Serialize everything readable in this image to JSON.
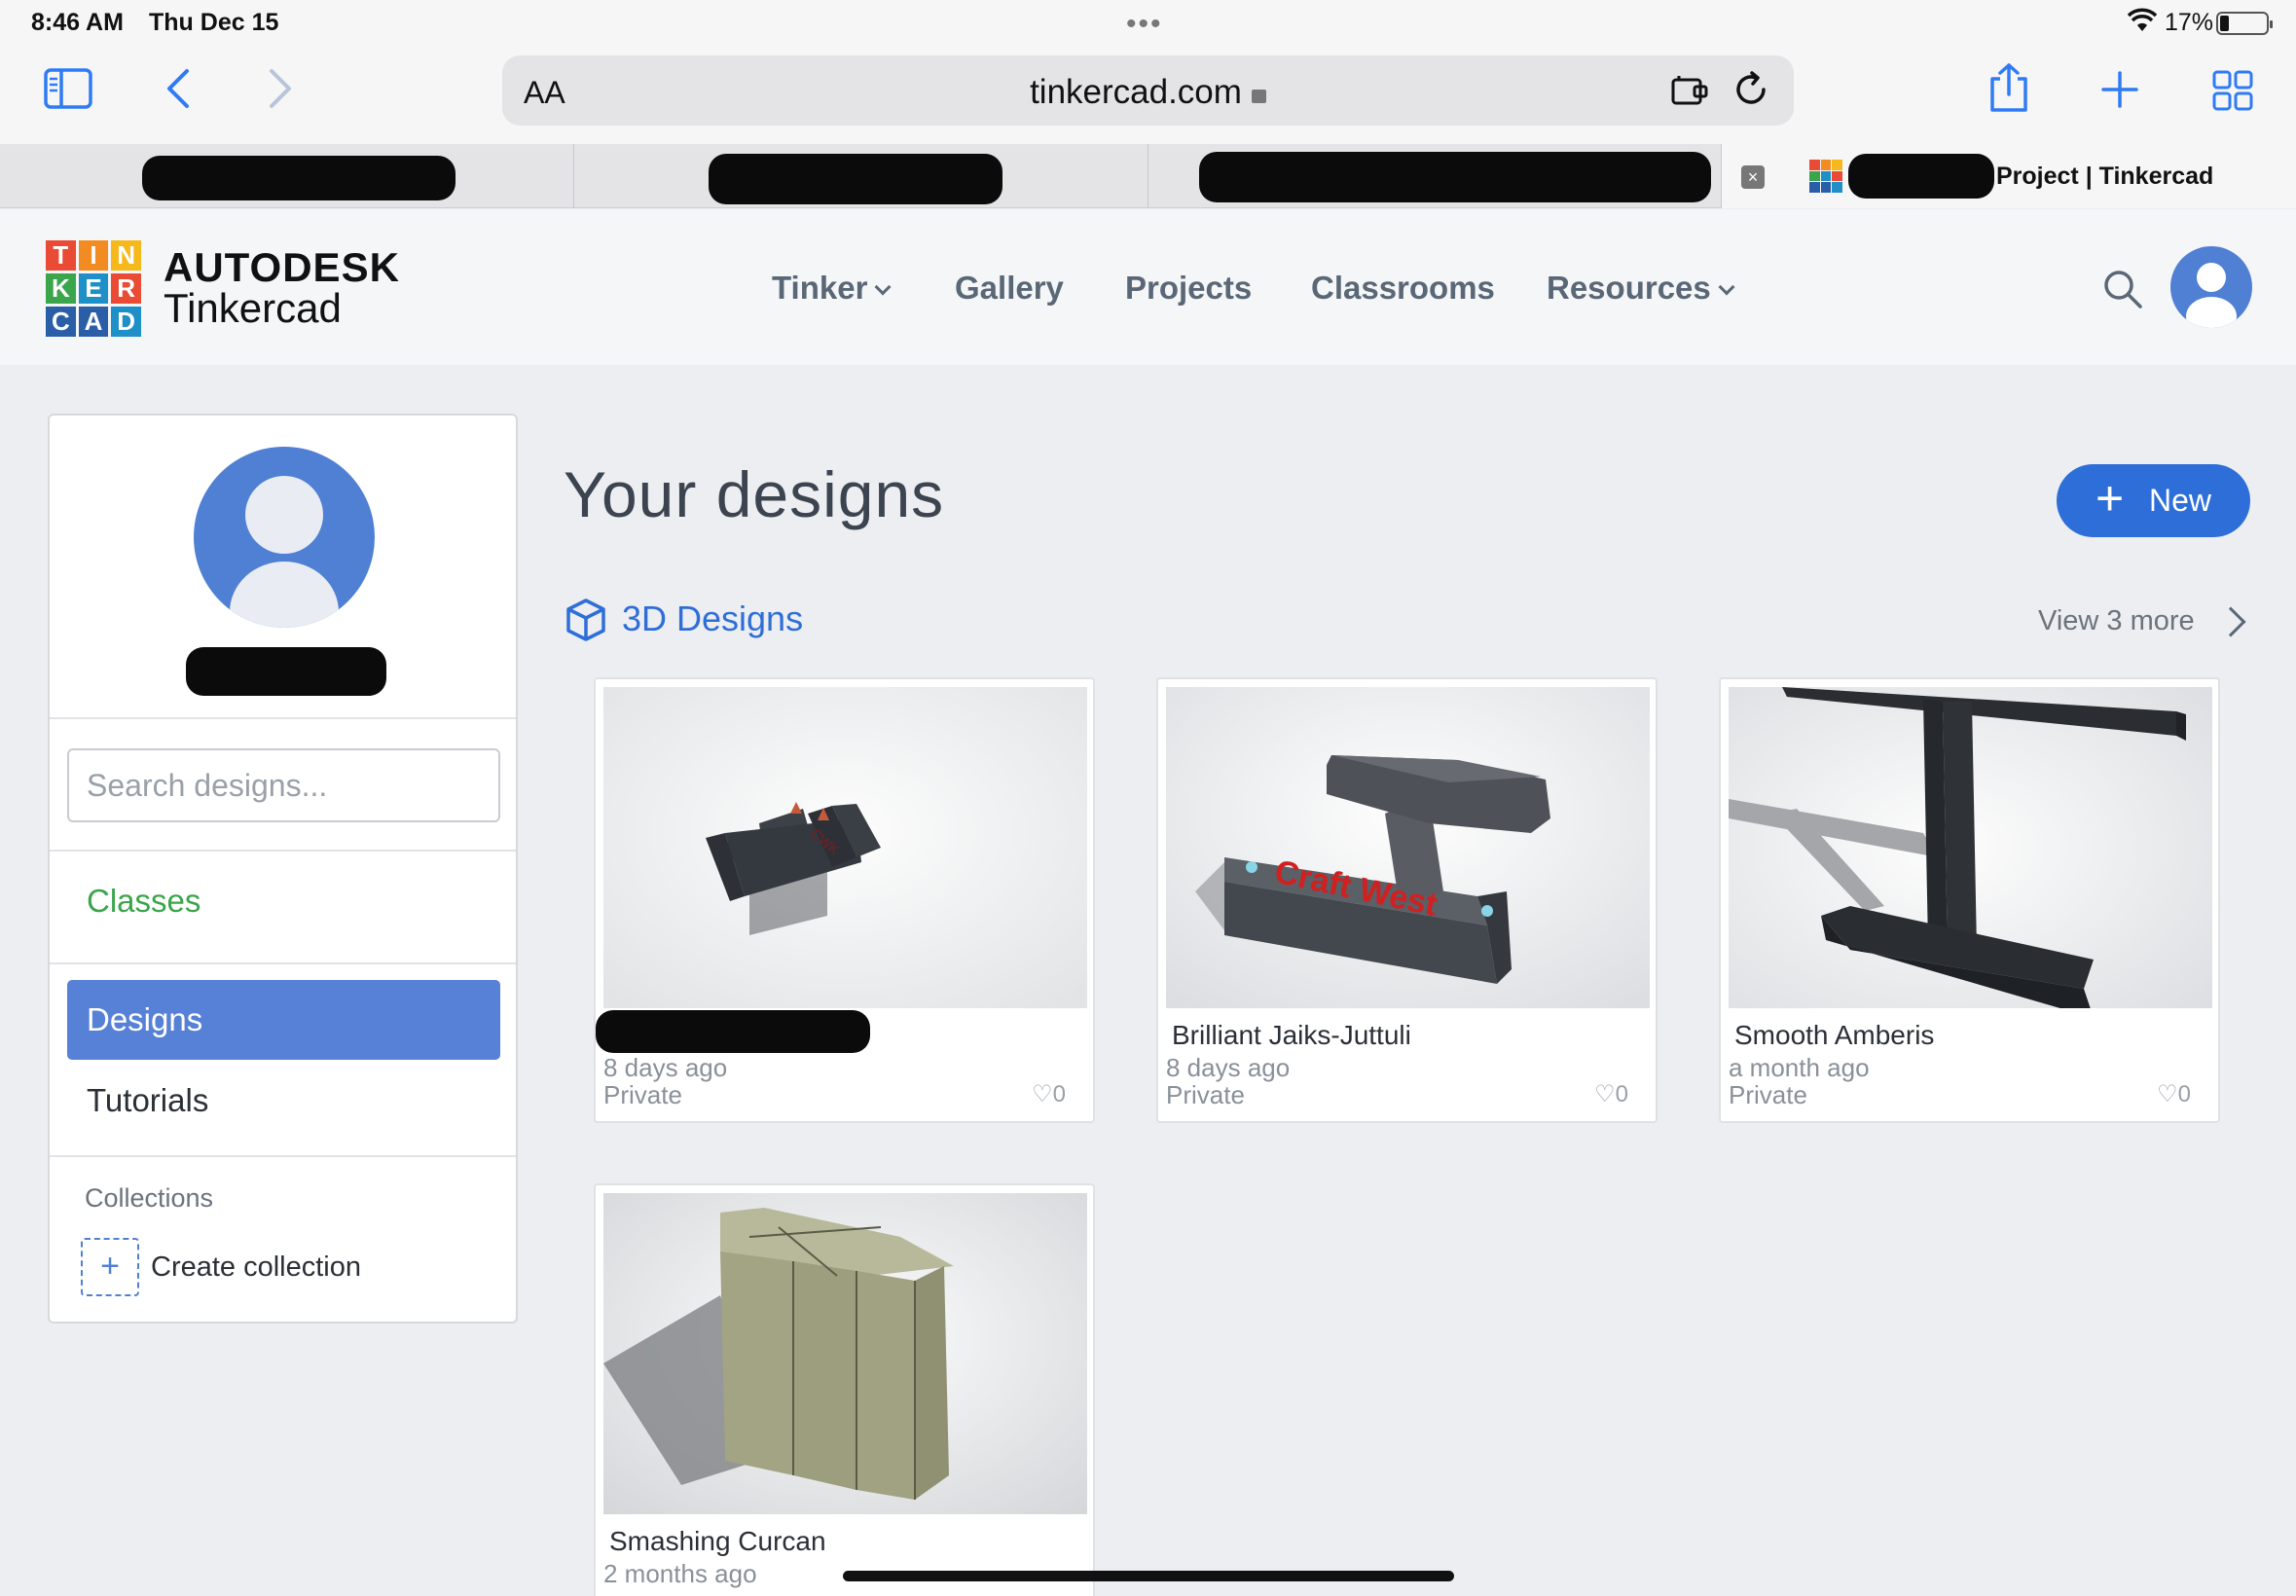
{
  "status_bar": {
    "time": "8:46 AM",
    "date": "Thu Dec 15",
    "battery": "17%"
  },
  "browser": {
    "aa_label": "AA",
    "url": "tinkercad.com",
    "active_tab_title": "Project | Tinkercad",
    "tab_close": "×"
  },
  "site": {
    "logo_letters": [
      "T",
      "I",
      "N",
      "K",
      "E",
      "R",
      "C",
      "A",
      "D"
    ],
    "logo_colors": [
      "#e94b35",
      "#f28b22",
      "#f6b81b",
      "#3aa54a",
      "#1e90c7",
      "#e94b35",
      "#2a5fa8",
      "#2a5fa8",
      "#1e90c7"
    ],
    "brand_line1": "AUTODESK",
    "brand_line2": "Tinkercad",
    "nav": [
      "Tinker",
      "Gallery",
      "Projects",
      "Classrooms",
      "Resources"
    ]
  },
  "sidebar": {
    "search_placeholder": "Search designs...",
    "classes": "Classes",
    "designs": "Designs",
    "tutorials": "Tutorials",
    "collections": "Collections",
    "create_collection": "Create collection"
  },
  "main": {
    "title": "Your designs",
    "new_button": "New",
    "section_title": "3D Designs",
    "view_more": "View 3 more",
    "designs": [
      {
        "name": "",
        "date": "8 days ago",
        "visibility": "Private",
        "likes": "♡0"
      },
      {
        "name": "Brilliant Jaiks-Juttuli",
        "date": "8 days ago",
        "visibility": "Private",
        "likes": "♡0"
      },
      {
        "name": "Smooth Amberis",
        "date": "a month ago",
        "visibility": "Private",
        "likes": "♡0"
      },
      {
        "name": "Smashing Curcan",
        "date": "2 months ago",
        "visibility": "",
        "likes": ""
      }
    ],
    "red_text_on_model": "Craft West"
  },
  "colors": {
    "accent": "#2e6ed8",
    "active_nav": "#5681d6",
    "classes_green": "#3aa54a"
  }
}
